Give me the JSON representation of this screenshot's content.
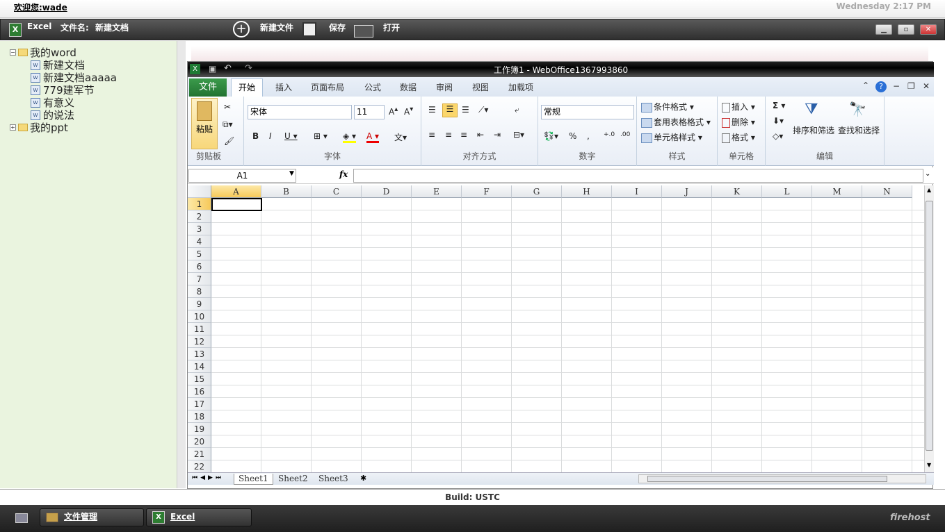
{
  "topbar": {
    "welcome": "欢迎您:wade",
    "clock": "Wednesday 2:17 PM"
  },
  "app": {
    "name": "Excel",
    "filename_label": "文件名:",
    "filename": "新建文档",
    "new_file": "新建文件",
    "save": "保存",
    "open": "打开"
  },
  "tree": {
    "folder1": "我的word",
    "doc1": "新建文档",
    "doc2": "新建文档aaaaa",
    "doc3": "779建军节",
    "doc4": "有意义",
    "doc5": "的说法",
    "folder2": "我的ppt"
  },
  "excel": {
    "title": "工作簿1 - WebOffice1367993860",
    "tabs": [
      "文件",
      "开始",
      "插入",
      "页面布局",
      "公式",
      "数据",
      "审阅",
      "视图",
      "加载项"
    ],
    "clipboard": {
      "paste": "粘贴",
      "label": "剪贴板"
    },
    "font": {
      "name": "宋体",
      "size": "11",
      "label": "字体"
    },
    "align": {
      "label": "对齐方式"
    },
    "number": {
      "format": "常规",
      "label": "数字"
    },
    "styles": {
      "cond": "条件格式",
      "table": "套用表格格式",
      "cell": "单元格样式",
      "label": "样式"
    },
    "cells": {
      "insert": "插入",
      "delete": "删除",
      "format": "格式",
      "label": "单元格"
    },
    "edit": {
      "sort": "排序和筛选",
      "find": "查找和选择",
      "label": "编辑"
    },
    "namebox": "A1",
    "fx": "fx",
    "columns": [
      "A",
      "B",
      "C",
      "D",
      "E",
      "F",
      "G",
      "H",
      "I",
      "J",
      "K",
      "L",
      "M",
      "N"
    ],
    "rows": [
      "1",
      "2",
      "3",
      "4",
      "5",
      "6",
      "7",
      "8",
      "9",
      "10",
      "11",
      "12",
      "13",
      "14",
      "15",
      "16",
      "17",
      "18",
      "19",
      "20",
      "21",
      "22"
    ],
    "sheets": [
      "Sheet1",
      "Sheet2",
      "Sheet3"
    ]
  },
  "footer": {
    "build": "Build: USTC",
    "brand": "firehost"
  },
  "taskbar": {
    "files": "文件管理",
    "excel": "Excel"
  }
}
